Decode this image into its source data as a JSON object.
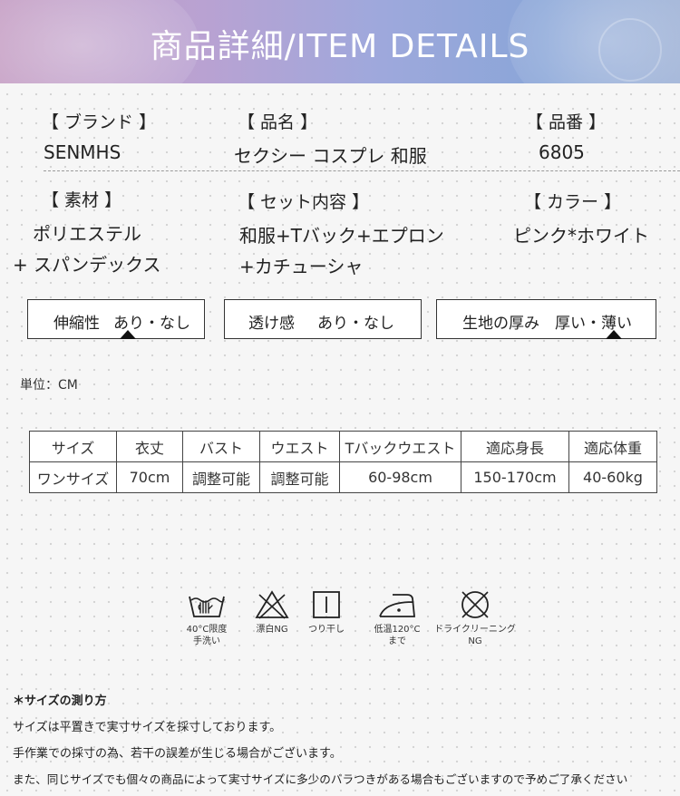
{
  "header": {
    "title": "商品詳細/ITEM DETAILS"
  },
  "info": {
    "brand_label": "【 ブランド 】",
    "brand_value": "SENMHS",
    "name_label": "【 品名 】",
    "name_value": "セクシー コスプレ 和服",
    "number_label": "【 品番 】",
    "number_value": "6805",
    "material_label": "【 素材 】",
    "material_line1": "ポリエステル",
    "material_line2": "+ スパンデックス",
    "set_label": "【 セット内容 】",
    "set_line1": "和服+Tバック+エプロン",
    "set_line2": "+カチューシャ",
    "color_label": "【 カラー 】",
    "color_value": "ピンク*ホワイト"
  },
  "properties": {
    "stretch_label": "伸縮性",
    "stretch_options": "あり・なし",
    "stretch_selected": "あり",
    "sheer_label": "透け感",
    "sheer_options": "あり・なし",
    "thickness_label": "生地の厚み",
    "thickness_options": "厚い・薄い",
    "thickness_selected": "薄い"
  },
  "unit_text": "単位：CM",
  "size_table": {
    "headers": [
      "サイズ",
      "衣丈",
      "バスト",
      "ウエスト",
      "Tバックウエスト",
      "適応身長",
      "適応体重"
    ],
    "row": [
      "ワンサイズ",
      "70cm",
      "調整可能",
      "調整可能",
      "60-98cm",
      "150-170cm",
      "40-60kg"
    ]
  },
  "care": [
    {
      "icon": "hand-wash-icon",
      "text1": "40°C限度",
      "text2": "手洗い"
    },
    {
      "icon": "no-bleach-icon",
      "text1": "漂白NG",
      "text2": ""
    },
    {
      "icon": "line-dry-icon",
      "text1": "つり干し",
      "text2": ""
    },
    {
      "icon": "iron-low-icon",
      "text1": "低温120°C",
      "text2": "まで"
    },
    {
      "icon": "no-dry-clean-icon",
      "text1": "ドライクリーニング",
      "text2": "NG"
    }
  ],
  "notes": {
    "title": "＊サイズの測り方",
    "line1": "サイズは平置きで実寸サイズを採寸しております。",
    "line2": "手作業での採寸の為、若干の誤差が生じる場合がございます。",
    "line3": "また、同じサイズでも個々の商品によって実寸サイズに多少のバラつきがある場合もございますので予めご了承ください"
  }
}
